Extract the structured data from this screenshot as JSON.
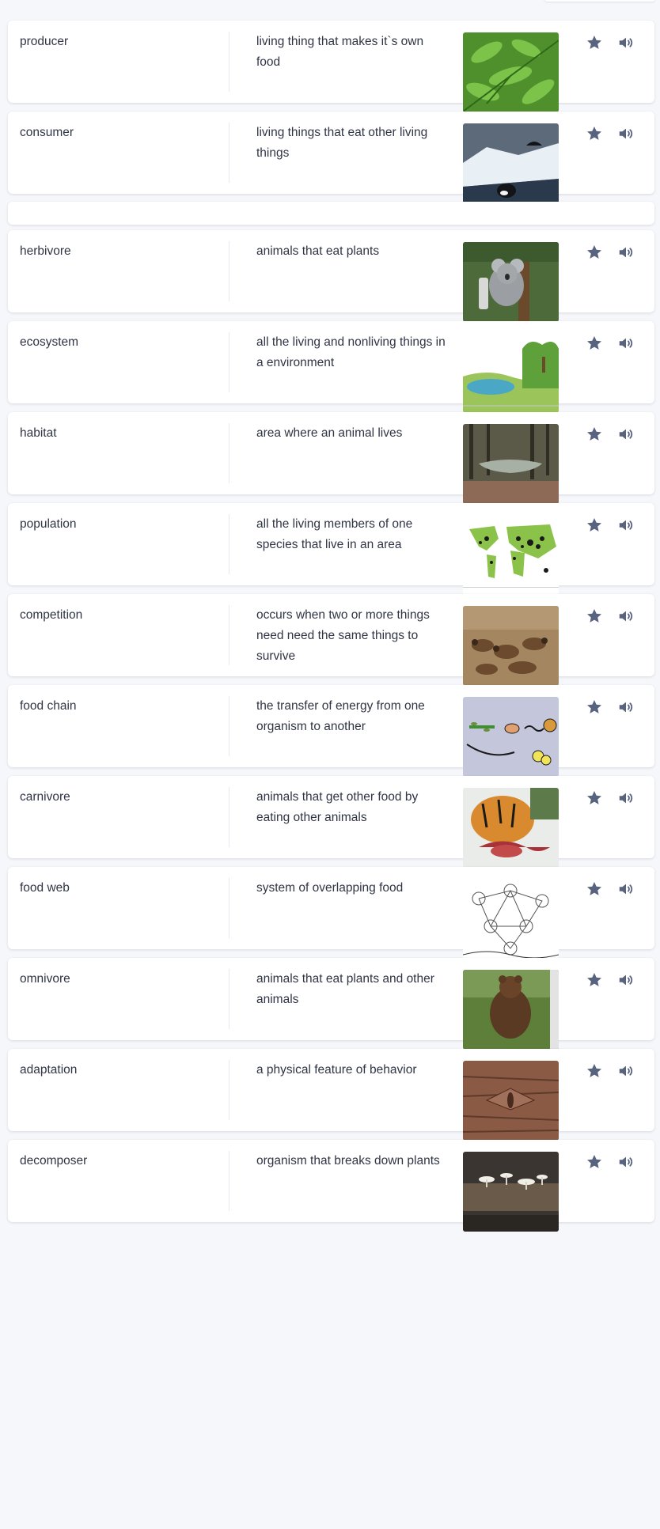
{
  "colors": {
    "background": "#f6f7fb",
    "card": "#ffffff",
    "text": "#303545",
    "icon": "#586380",
    "divider": "#e6e8ef"
  },
  "icons": {
    "star": "star-icon",
    "audio": "speaker-icon"
  },
  "cards": [
    {
      "term": "producer",
      "definition": "living thing that makes it`s own food",
      "image": "plant-leaves"
    },
    {
      "term": "consumer",
      "definition": "living things that eat other living things",
      "image": "orca-on-ice"
    },
    {
      "empty": true
    },
    {
      "term": "herbivore",
      "definition": "animals that eat plants",
      "image": "koala-in-tree"
    },
    {
      "term": "ecosystem",
      "definition": "all the living and nonliving things in a environment",
      "image": "ecosystem-illustration"
    },
    {
      "term": "habitat",
      "definition": "area where an animal lives",
      "image": "forest-creek"
    },
    {
      "term": "population",
      "definition": "all the living members of one species that live in an area",
      "image": "world-population-map"
    },
    {
      "term": "competition",
      "definition": "occurs when two or more things need need the same things to survive",
      "image": "wild-dogs-feeding"
    },
    {
      "term": "food chain",
      "definition": "the transfer of energy from one organism to another",
      "image": "food-chain-drawing"
    },
    {
      "term": "carnivore",
      "definition": "animals that get other food by eating other animals",
      "image": "tiger-eating"
    },
    {
      "term": "food web",
      "definition": "system of overlapping food",
      "image": "food-web-sketch"
    },
    {
      "term": "omnivore",
      "definition": "animals that eat plants and other animals",
      "image": "brown-bear"
    },
    {
      "term": "adaptation",
      "definition": "a physical feature of behavior",
      "image": "camouflaged-moth"
    },
    {
      "term": "decomposer",
      "definition": "organism that breaks down plants",
      "image": "mushrooms-on-log"
    }
  ]
}
